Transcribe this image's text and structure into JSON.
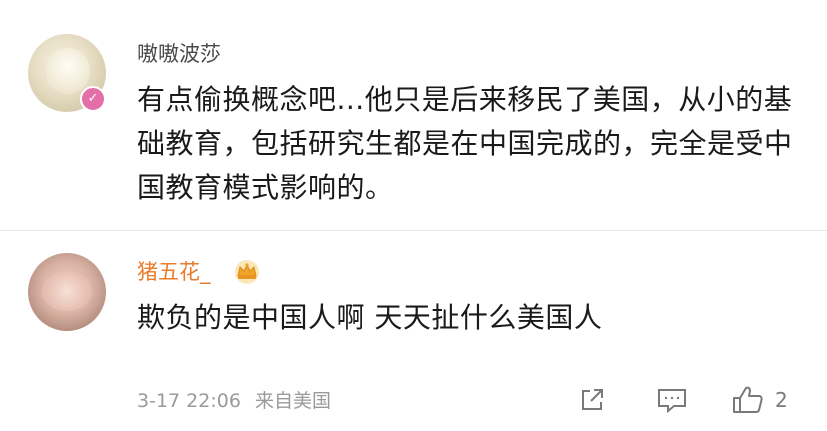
{
  "comments": [
    {
      "username": "嗷嗷波莎",
      "text": "有点偷换概念吧...他只是后来移民了美国，从小的基础教育，包括研究生都是在中国完成的，完全是受中国教育模式影响的。",
      "avatar": "beige-blur-avatar",
      "badge": "verified-badge"
    },
    {
      "username": "猪五花_",
      "text": "欺负的是中国人啊 天天扯什么美国人",
      "avatar": "pink-pig-avatar",
      "badge": "crown-icon",
      "timestamp": "3-17 22:06",
      "location": "来自美国",
      "like_count": "2"
    }
  ],
  "colors": {
    "username_default": "#4a4a4a",
    "username_vip": "#ea7c2c",
    "verified_badge": "#e36fa8",
    "meta_text": "#9a9a9a",
    "icon": "#7a7a7a",
    "divider": "#e6e6e6"
  },
  "icons": {
    "share": "share-icon",
    "reply": "comment-icon",
    "like": "thumbs-up-icon"
  }
}
